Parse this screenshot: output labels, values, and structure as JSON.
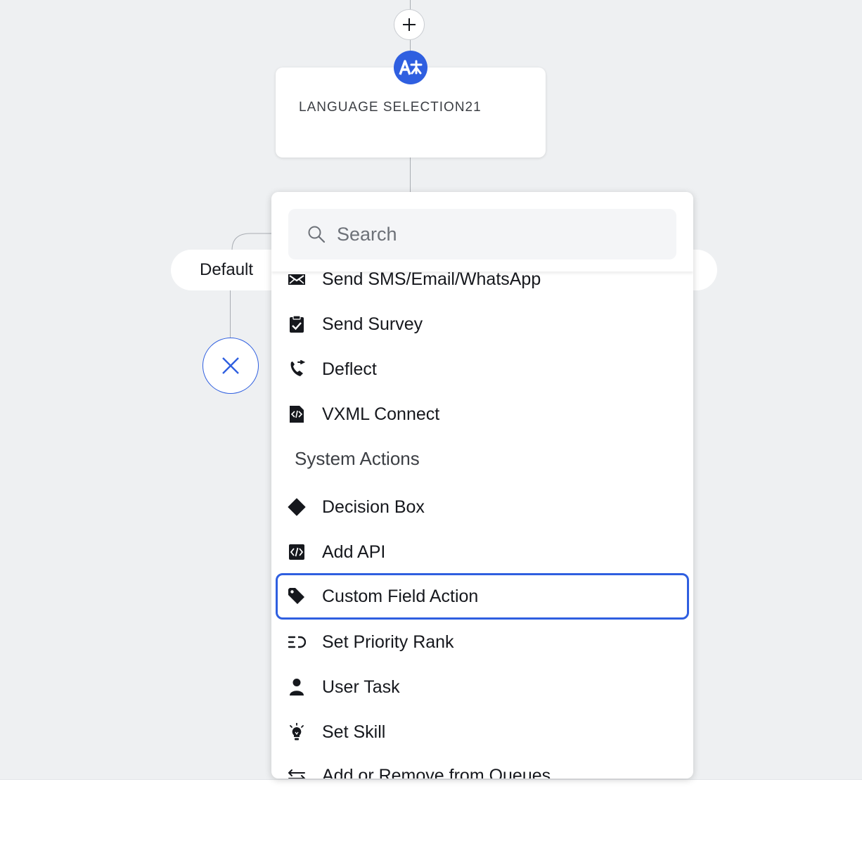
{
  "canvas": {
    "node": {
      "title": "LANGUAGE SELECTION21"
    },
    "branch": {
      "default_label": "Default"
    }
  },
  "icons": {
    "add": "plus-icon",
    "language": "translate-icon",
    "close": "close-icon",
    "search": "search-icon"
  },
  "dropdown": {
    "search": {
      "placeholder": "Search",
      "value": ""
    },
    "items": [
      {
        "label": "Send SMS/Email/WhatsApp",
        "icon": "envelope-icon"
      },
      {
        "label": "Send Survey",
        "icon": "clipboard-check-icon"
      },
      {
        "label": "Deflect",
        "icon": "phone-redirect-icon"
      },
      {
        "label": "VXML Connect",
        "icon": "code-file-icon"
      }
    ],
    "section": "System Actions",
    "system_items": [
      {
        "label": "Decision Box",
        "icon": "diamond-icon"
      },
      {
        "label": "Add API",
        "icon": "code-icon"
      },
      {
        "label": "Custom Field Action",
        "icon": "tag-icon",
        "selected": true
      },
      {
        "label": "Set Priority Rank",
        "icon": "priority-icon"
      },
      {
        "label": "User Task",
        "icon": "user-icon"
      },
      {
        "label": "Set Skill",
        "icon": "lightbulb-icon"
      },
      {
        "label": "Add or Remove from Queues",
        "icon": "swap-arrows-icon"
      }
    ]
  },
  "colors": {
    "accent": "#2f5fe0",
    "canvas": "#eef0f2",
    "text": "#16181d"
  }
}
